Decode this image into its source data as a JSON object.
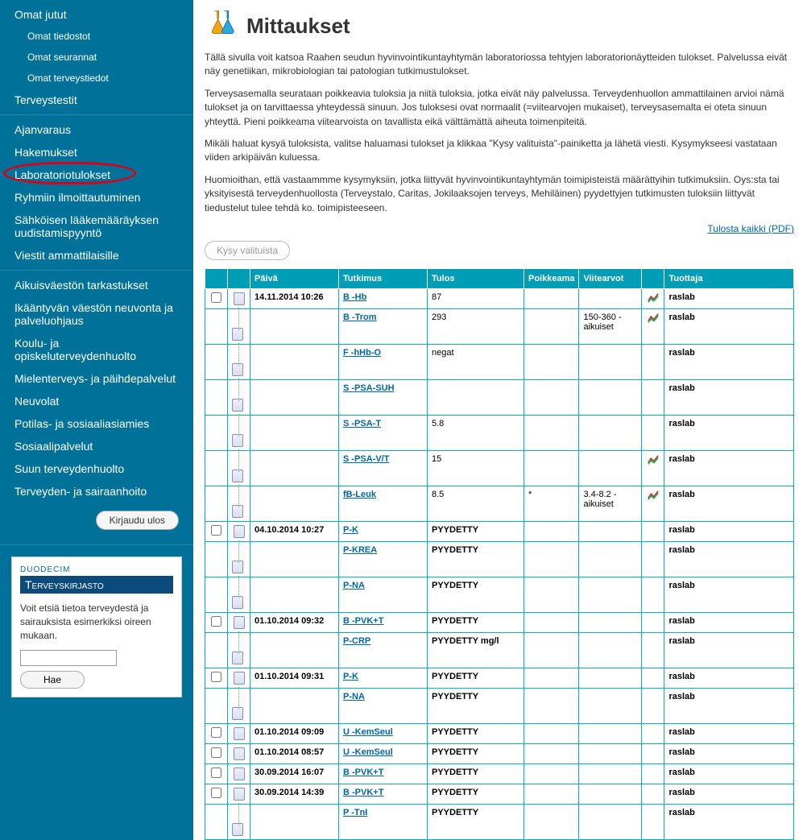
{
  "sidebar": {
    "group_personal": {
      "title": "Omat jutut",
      "items": [
        "Omat tiedostot",
        "Omat seurannat",
        "Omat terveystiedot"
      ]
    },
    "health_tests": "Terveystestit",
    "group_services": [
      "Ajanvaraus",
      "Hakemukset",
      "Laboratoriotulokset",
      "Ryhmiin ilmoittautuminen",
      "Sähköisen lääkemääräyksen uudistamispyyntö",
      "Viestit ammattilaisille"
    ],
    "group_pop": [
      "Aikuisväestön tarkastukset",
      "Ikääntyvän väestön neuvonta ja palveluohjaus",
      "Koulu- ja opiskeluterveydenhuolto",
      "Mielenterveys- ja päihdepalvelut",
      "Neuvolat",
      "Potilas- ja sosiaaliasiamies",
      "Sosiaalipalvelut",
      "Suun terveydenhuolto",
      "Terveyden- ja sairaanhoito"
    ],
    "logout": "Kirjaudu ulos"
  },
  "widget": {
    "brand_small": "DUODECIM",
    "brand": "Terveyskirjasto",
    "text": "Voit etsiä tietoa terveydestä ja sairauksista esimerkiksi oireen mukaan.",
    "search_btn": "Hae"
  },
  "page": {
    "title": "Mittaukset",
    "p1": "Tällä sivulla voit katsoa Raahen seudun hyvinvointikuntayhtymän laboratoriossa tehtyjen laboratorionäytteiden tulokset. Palvelussa eivät näy genetiikan, mikrobiologian tai patologian tutkimustulokset.",
    "p2": "Terveysasemalla seurataan poikkeavia tuloksia ja niitä tuloksia, jotka eivät näy palvelussa. Terveydenhuollon ammattilainen arvioi nämä tulokset ja on tarvittaessa yhteydessä sinuun. Jos tuloksesi ovat normaalit (=viitearvojen mukaiset), terveysasemalta ei oteta sinuun yhteyttä. Pieni poikkeama viitearvoista on tavallista eikä välttämättä aiheuta toimenpiteitä.",
    "p3": "Mikäli haluat kysyä tuloksista, valitse haluamasi tulokset ja klikkaa \"Kysy valituista\"-painiketta ja lähetä viesti. Kysymykseesi vastataan viiden arkipäivän kuluessa.",
    "p4": "Huomioithan, että vastaammme kysymyksiin, jotka liittyvät hyvinvointikuntayhtymän toimipisteistä määrättyihin tutkimuksiin. Oys:sta tai yksityisestä terveydenhuollosta (Terveystalo, Caritas, Jokilaaksojen terveys, Mehiläinen) pyydettyjen tutkimusten tuloksiin liittyvät tiedustelut tulee tehdä ko. toimipisteeseen.",
    "pdf_link": "Tulosta kaikki (PDF)",
    "ask_btn": "Kysy valituista"
  },
  "table": {
    "headers": {
      "date": "Päivä",
      "study": "Tutkimus",
      "result": "Tulos",
      "deviation": "Poikkeama",
      "ref": "Viitearvot",
      "producer": "Tuottaja"
    },
    "rows": [
      {
        "cb": true,
        "tree": "doc",
        "date": "14.11.2014 10:26",
        "study": "B -Hb",
        "result": "87",
        "dev": "",
        "ref": "",
        "flag": true,
        "prod": "raslab"
      },
      {
        "cb": false,
        "tree": "mid",
        "date": "",
        "study": "B -Trom",
        "result": "293",
        "dev": "",
        "ref": "150-360 - aikuiset",
        "flag": true,
        "prod": "raslab"
      },
      {
        "cb": false,
        "tree": "mid",
        "date": "",
        "study": "F -hHb-O",
        "result": "negat",
        "dev": "",
        "ref": "",
        "flag": false,
        "prod": "raslab"
      },
      {
        "cb": false,
        "tree": "mid",
        "date": "",
        "study": "S -PSA-SUH",
        "result": "",
        "dev": "",
        "ref": "",
        "flag": false,
        "prod": "raslab"
      },
      {
        "cb": false,
        "tree": "mid",
        "date": "",
        "study": "S -PSA-T",
        "result": "5.8",
        "dev": "",
        "ref": "",
        "flag": false,
        "prod": "raslab"
      },
      {
        "cb": false,
        "tree": "mid",
        "date": "",
        "study": "S -PSA-V/T",
        "result": "15",
        "dev": "",
        "ref": "",
        "flag": true,
        "prod": "raslab"
      },
      {
        "cb": false,
        "tree": "end",
        "date": "",
        "study": "fB-Leuk",
        "result": "8.5",
        "dev": "*",
        "ref": "3.4-8.2 - aikuiset",
        "flag": true,
        "prod": "raslab"
      },
      {
        "cb": true,
        "tree": "doc",
        "date": "04.10.2014 10:27",
        "study": "P-K",
        "result": "PYYDETTY",
        "dev": "",
        "ref": "",
        "flag": false,
        "prod": "raslab"
      },
      {
        "cb": false,
        "tree": "mid",
        "date": "",
        "study": "P-KREA",
        "result": "PYYDETTY",
        "dev": "",
        "ref": "",
        "flag": false,
        "prod": "raslab"
      },
      {
        "cb": false,
        "tree": "end",
        "date": "",
        "study": "P-NA",
        "result": "PYYDETTY",
        "dev": "",
        "ref": "",
        "flag": false,
        "prod": "raslab"
      },
      {
        "cb": true,
        "tree": "doc",
        "date": "01.10.2014 09:32",
        "study": "B -PVK+T",
        "result": "PYYDETTY",
        "dev": "",
        "ref": "",
        "flag": false,
        "prod": "raslab"
      },
      {
        "cb": false,
        "tree": "end",
        "date": "",
        "study": "P-CRP",
        "result": "PYYDETTY mg/l",
        "dev": "",
        "ref": "",
        "flag": false,
        "prod": "raslab"
      },
      {
        "cb": true,
        "tree": "doc",
        "date": "01.10.2014 09:31",
        "study": "P-K",
        "result": "PYYDETTY",
        "dev": "",
        "ref": "",
        "flag": false,
        "prod": "raslab"
      },
      {
        "cb": false,
        "tree": "end",
        "date": "",
        "study": "P-NA",
        "result": "PYYDETTY",
        "dev": "",
        "ref": "",
        "flag": false,
        "prod": "raslab"
      },
      {
        "cb": true,
        "tree": "single",
        "date": "01.10.2014 09:09",
        "study": "U -KemSeul",
        "result": "PYYDETTY",
        "dev": "",
        "ref": "",
        "flag": false,
        "prod": "raslab"
      },
      {
        "cb": true,
        "tree": "single",
        "date": "01.10.2014 08:57",
        "study": "U -KemSeul",
        "result": "PYYDETTY",
        "dev": "",
        "ref": "",
        "flag": false,
        "prod": "raslab"
      },
      {
        "cb": true,
        "tree": "single",
        "date": "30.09.2014 16:07",
        "study": "B -PVK+T",
        "result": "PYYDETTY",
        "dev": "",
        "ref": "",
        "flag": false,
        "prod": "raslab"
      },
      {
        "cb": true,
        "tree": "doc",
        "date": "30.09.2014 14:39",
        "study": "B -PVK+T",
        "result": "PYYDETTY",
        "dev": "",
        "ref": "",
        "flag": false,
        "prod": "raslab"
      },
      {
        "cb": false,
        "tree": "mid",
        "date": "",
        "study": "P -TnI",
        "result": "PYYDETTY",
        "dev": "",
        "ref": "",
        "flag": false,
        "prod": "raslab"
      }
    ]
  }
}
